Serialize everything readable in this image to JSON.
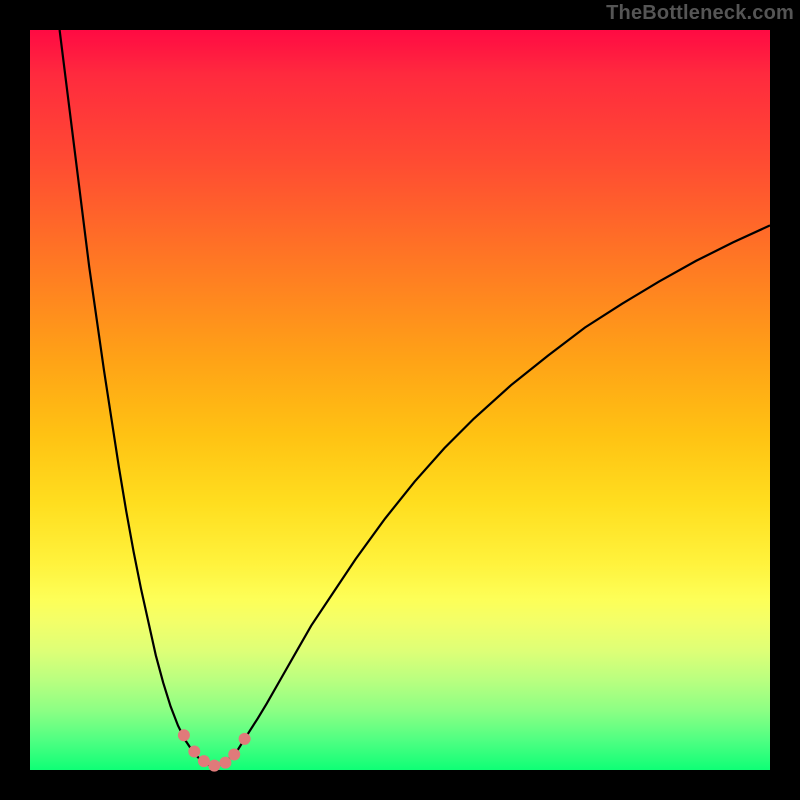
{
  "watermark": "TheBottleneck.com",
  "colors": {
    "background": "#000000",
    "gradient_top": "#ff0a43",
    "gradient_bottom": "#0fff76",
    "curve": "#000000",
    "dots": "#e07a7a"
  },
  "chart_data": {
    "type": "line",
    "title": "",
    "xlabel": "",
    "ylabel": "",
    "xlim": [
      0,
      100
    ],
    "ylim": [
      0,
      100
    ],
    "grid": false,
    "legend": false,
    "x": [
      4,
      5,
      6,
      7,
      8,
      9,
      10,
      11,
      12,
      13,
      14,
      15,
      16,
      17,
      18,
      19,
      20,
      21,
      22,
      23,
      24.3,
      25.7,
      27,
      28,
      29,
      30.8,
      32,
      34,
      36,
      38,
      41,
      44,
      48,
      52,
      56,
      60,
      65,
      70,
      75,
      80,
      85,
      90,
      95,
      100
    ],
    "y": [
      100,
      92,
      84,
      76,
      68,
      61,
      54,
      47.5,
      41,
      35,
      29.5,
      24.5,
      20,
      15.5,
      11.8,
      8.6,
      6,
      4,
      2.5,
      1.4,
      0.6,
      0.7,
      1.6,
      2.6,
      4.2,
      7,
      9,
      12.5,
      16,
      19.5,
      24,
      28.5,
      34,
      39,
      43.5,
      47.5,
      52,
      56,
      59.8,
      63,
      66,
      68.8,
      71.3,
      73.6
    ],
    "markers": {
      "x": [
        20.8,
        22.2,
        23.5,
        24.9,
        26.4,
        27.6,
        29
      ],
      "y": [
        4.7,
        2.5,
        1.2,
        0.6,
        1,
        2.1,
        4.2
      ]
    }
  }
}
